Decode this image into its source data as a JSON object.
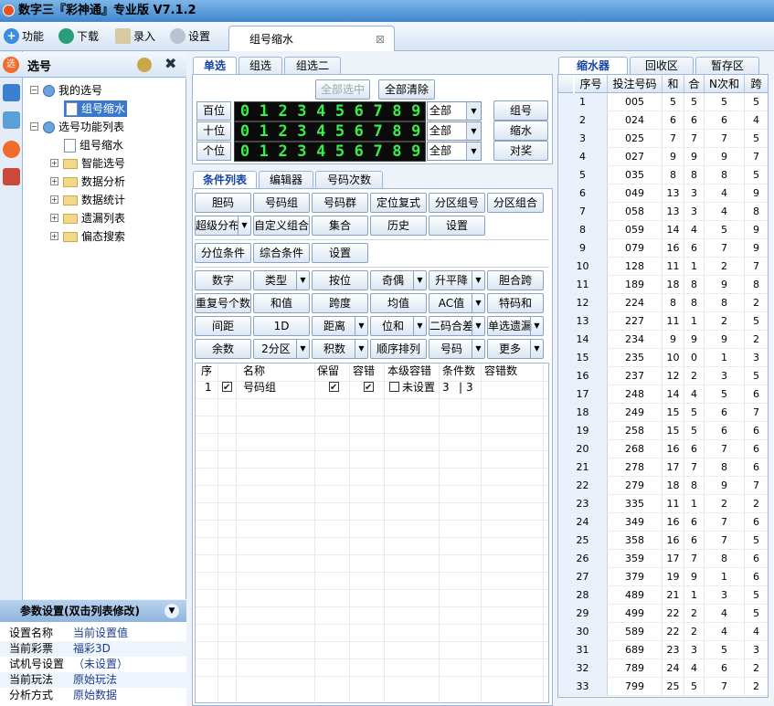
{
  "app": {
    "title": "数字三『彩神通』专业版  V7.1.2"
  },
  "toolbar": {
    "func": "功能",
    "download": "下载",
    "entry": "录入",
    "settings": "设置"
  },
  "doc_tab": {
    "label": "组号缩水",
    "close": "⊠"
  },
  "left": {
    "title": "选号",
    "tree": [
      {
        "label": "我的选号",
        "kind": "root",
        "exp": "−"
      },
      {
        "label": "组号缩水",
        "kind": "doc",
        "selected": true
      },
      {
        "label": "选号功能列表",
        "kind": "root",
        "exp": "−"
      },
      {
        "label": "组号缩水",
        "kind": "doc"
      },
      {
        "label": "智能选号",
        "kind": "folder",
        "exp": "+"
      },
      {
        "label": "数据分析",
        "kind": "folder",
        "exp": "+"
      },
      {
        "label": "数据统计",
        "kind": "folder",
        "exp": "+"
      },
      {
        "label": "遗漏列表",
        "kind": "folder",
        "exp": "+"
      },
      {
        "label": "偏态搜索",
        "kind": "folder",
        "exp": "+"
      }
    ]
  },
  "params": {
    "header": "参数设置(双击列表修改)",
    "rows": [
      {
        "k": "设置名称",
        "v": "当前设置值"
      },
      {
        "k": "当前彩票",
        "v": "福彩3D"
      },
      {
        "k": "试机号设置",
        "v": "（未设置）"
      },
      {
        "k": "当前玩法",
        "v": "原始玩法"
      },
      {
        "k": "分析方式",
        "v": "原始数据"
      }
    ]
  },
  "top_tabs": [
    "单选",
    "组选",
    "组选二"
  ],
  "pick": {
    "select_all": "全部选中",
    "clear_all": "全部清除",
    "rows": [
      {
        "label": "百位",
        "sel": "全部"
      },
      {
        "label": "十位",
        "sel": "全部"
      },
      {
        "label": "个位",
        "sel": "全部"
      }
    ],
    "digits": [
      "0",
      "1",
      "2",
      "3",
      "4",
      "5",
      "6",
      "7",
      "8",
      "9"
    ],
    "side": [
      "组号",
      "缩水",
      "对奖"
    ]
  },
  "cond_tabs": [
    "条件列表",
    "编辑器",
    "号码次数"
  ],
  "btns1": [
    "胆码",
    "号码组",
    "号码群",
    "定位复式",
    "分区组号",
    "分区组合"
  ],
  "btns2": [
    "超级分布",
    "自定义组合",
    "集合",
    "历史",
    "设置"
  ],
  "btns3": [
    "分位条件",
    "综合条件",
    "设置"
  ],
  "btns4": [
    "数字",
    "类型",
    "按位",
    "奇偶",
    "升平降",
    "胆合跨"
  ],
  "btns5": [
    "重复号个数",
    "和值",
    "跨度",
    "均值",
    "AC值",
    "特码和"
  ],
  "btns6": [
    "间距",
    "1D",
    "距离",
    "位和",
    "二码合差",
    "单选遗漏"
  ],
  "btns7": [
    "余数",
    "2分区",
    "积数",
    "顺序排列",
    "号码",
    "更多"
  ],
  "grid": {
    "headers": [
      "序",
      "",
      "名称",
      "保留",
      "容错",
      "本级容错",
      "条件数",
      "容错数"
    ],
    "row": {
      "idx": "1",
      "name": "号码组",
      "level": "未设置",
      "cond": "3",
      "tol": "3"
    }
  },
  "right_tabs": [
    "缩水器",
    "回收区",
    "暂存区"
  ],
  "rtable": {
    "headers": [
      "序号",
      "投注号码",
      "和",
      "合",
      "N次和",
      "跨"
    ],
    "rows": [
      [
        "1",
        "005",
        "5",
        "5",
        "5",
        "5"
      ],
      [
        "2",
        "024",
        "6",
        "6",
        "6",
        "4"
      ],
      [
        "3",
        "025",
        "7",
        "7",
        "7",
        "5"
      ],
      [
        "4",
        "027",
        "9",
        "9",
        "9",
        "7"
      ],
      [
        "5",
        "035",
        "8",
        "8",
        "8",
        "5"
      ],
      [
        "6",
        "049",
        "13",
        "3",
        "4",
        "9"
      ],
      [
        "7",
        "058",
        "13",
        "3",
        "4",
        "8"
      ],
      [
        "8",
        "059",
        "14",
        "4",
        "5",
        "9"
      ],
      [
        "9",
        "079",
        "16",
        "6",
        "7",
        "9"
      ],
      [
        "10",
        "128",
        "11",
        "1",
        "2",
        "7"
      ],
      [
        "11",
        "189",
        "18",
        "8",
        "9",
        "8"
      ],
      [
        "12",
        "224",
        "8",
        "8",
        "8",
        "2"
      ],
      [
        "13",
        "227",
        "11",
        "1",
        "2",
        "5"
      ],
      [
        "14",
        "234",
        "9",
        "9",
        "9",
        "2"
      ],
      [
        "15",
        "235",
        "10",
        "0",
        "1",
        "3"
      ],
      [
        "16",
        "237",
        "12",
        "2",
        "3",
        "5"
      ],
      [
        "17",
        "248",
        "14",
        "4",
        "5",
        "6"
      ],
      [
        "18",
        "249",
        "15",
        "5",
        "6",
        "7"
      ],
      [
        "19",
        "258",
        "15",
        "5",
        "6",
        "6"
      ],
      [
        "20",
        "268",
        "16",
        "6",
        "7",
        "6"
      ],
      [
        "21",
        "278",
        "17",
        "7",
        "8",
        "6"
      ],
      [
        "22",
        "279",
        "18",
        "8",
        "9",
        "7"
      ],
      [
        "23",
        "335",
        "11",
        "1",
        "2",
        "2"
      ],
      [
        "24",
        "349",
        "16",
        "6",
        "7",
        "6"
      ],
      [
        "25",
        "358",
        "16",
        "6",
        "7",
        "5"
      ],
      [
        "26",
        "359",
        "17",
        "7",
        "8",
        "6"
      ],
      [
        "27",
        "379",
        "19",
        "9",
        "1",
        "6"
      ],
      [
        "28",
        "489",
        "21",
        "1",
        "3",
        "5"
      ],
      [
        "29",
        "499",
        "22",
        "2",
        "4",
        "5"
      ],
      [
        "30",
        "589",
        "22",
        "2",
        "4",
        "4"
      ],
      [
        "31",
        "689",
        "23",
        "3",
        "5",
        "3"
      ],
      [
        "32",
        "789",
        "24",
        "4",
        "6",
        "2"
      ],
      [
        "33",
        "799",
        "25",
        "5",
        "7",
        "2"
      ]
    ]
  }
}
